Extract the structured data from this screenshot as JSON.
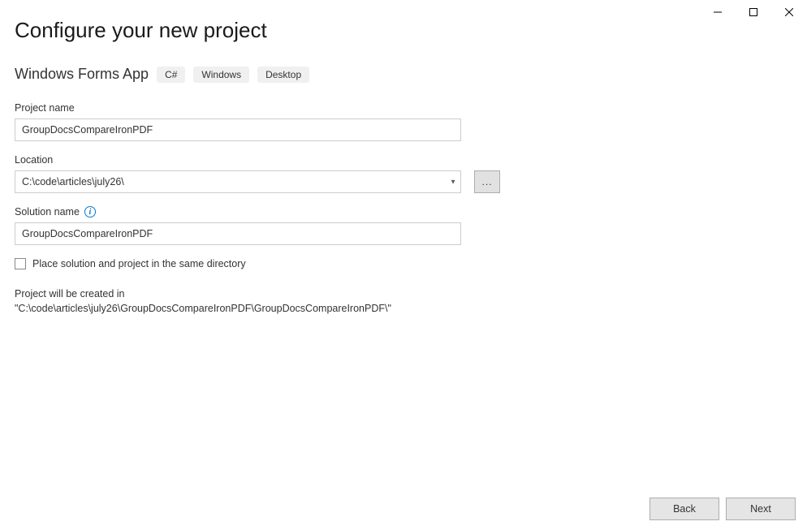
{
  "window": {
    "minimize": "minimize",
    "maximize": "maximize",
    "close": "close"
  },
  "header": {
    "title": "Configure your new project",
    "template_name": "Windows Forms App",
    "tags": [
      "C#",
      "Windows",
      "Desktop"
    ]
  },
  "form": {
    "project_name_label": "Project name",
    "project_name_value": "GroupDocsCompareIronPDF",
    "location_label": "Location",
    "location_value": "C:\\code\\articles\\july26\\",
    "browse_label": "...",
    "solution_name_label": "Solution name",
    "solution_name_value": "GroupDocsCompareIronPDF",
    "same_directory_label": "Place solution and project in the same directory",
    "creation_path_text": "Project will be created in \"C:\\code\\articles\\july26\\GroupDocsCompareIronPDF\\GroupDocsCompareIronPDF\\\""
  },
  "footer": {
    "back_label": "Back",
    "next_label": "Next"
  }
}
